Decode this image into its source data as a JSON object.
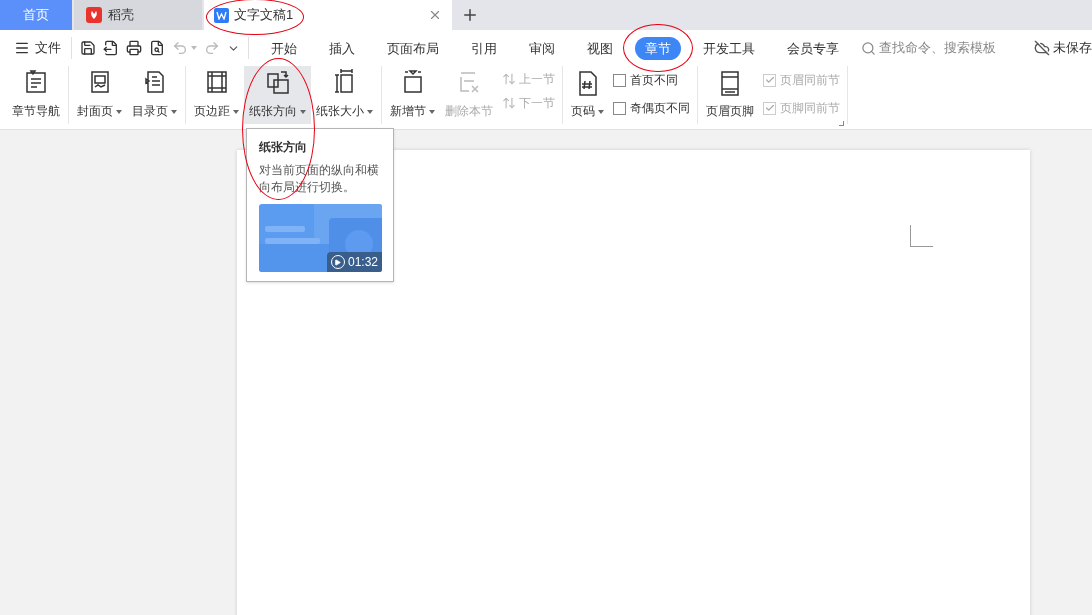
{
  "tabs": [
    {
      "kind": "home",
      "label": "首页",
      "selected": false,
      "circled": false
    },
    {
      "kind": "app",
      "label": "稻壳",
      "selected": false,
      "circled": false
    },
    {
      "kind": "doc",
      "label": "文字文稿1",
      "selected": true,
      "circled": true
    }
  ],
  "file_menu": {
    "label": "文件"
  },
  "menu_tabs": [
    {
      "label": "开始",
      "selected": false,
      "circled": false
    },
    {
      "label": "插入",
      "selected": false,
      "circled": false
    },
    {
      "label": "页面布局",
      "selected": false,
      "circled": false
    },
    {
      "label": "引用",
      "selected": false,
      "circled": false
    },
    {
      "label": "审阅",
      "selected": false,
      "circled": false
    },
    {
      "label": "视图",
      "selected": false,
      "circled": false
    },
    {
      "label": "章节",
      "selected": true,
      "circled": true
    },
    {
      "label": "开发工具",
      "selected": false,
      "circled": false
    },
    {
      "label": "会员专享",
      "selected": false,
      "circled": false
    }
  ],
  "search": {
    "placeholder": "查找命令、搜索模板"
  },
  "save_status": "未保存",
  "ribbon_groups": [
    {
      "items": [
        {
          "kind": "large",
          "label": "章节导航",
          "dropdown": false,
          "disabled": false,
          "hovered": false,
          "circled": false
        }
      ]
    },
    {
      "items": [
        {
          "kind": "large",
          "label": "封面页",
          "dropdown": true,
          "disabled": false,
          "hovered": false,
          "circled": false
        },
        {
          "kind": "large",
          "label": "目录页",
          "dropdown": true,
          "disabled": false,
          "hovered": false,
          "circled": false
        }
      ]
    },
    {
      "items": [
        {
          "kind": "large",
          "label": "页边距",
          "dropdown": true,
          "disabled": false,
          "hovered": false,
          "circled": false
        },
        {
          "kind": "large",
          "label": "纸张方向",
          "dropdown": true,
          "disabled": false,
          "hovered": true,
          "circled": true
        },
        {
          "kind": "large",
          "label": "纸张大小",
          "dropdown": true,
          "disabled": false,
          "hovered": false,
          "circled": false
        }
      ]
    },
    {
      "items": [
        {
          "kind": "large",
          "label": "新增节",
          "dropdown": true,
          "disabled": false,
          "hovered": false,
          "circled": false
        },
        {
          "kind": "large",
          "label": "删除本节",
          "dropdown": false,
          "disabled": true,
          "hovered": false,
          "circled": false
        },
        {
          "kind": "nav",
          "entries": [
            {
              "label": "上一节",
              "disabled": true
            },
            {
              "label": "下一节",
              "disabled": true
            }
          ]
        }
      ]
    },
    {
      "items": [
        {
          "kind": "large",
          "label": "页码",
          "dropdown": true,
          "disabled": false,
          "hovered": false,
          "circled": false
        },
        {
          "kind": "checks",
          "entries": [
            {
              "label": "首页不同",
              "checked": false,
              "disabled": false
            },
            {
              "label": "奇偶页不同",
              "checked": false,
              "disabled": false
            }
          ]
        }
      ]
    },
    {
      "launcher": true,
      "items": [
        {
          "kind": "large",
          "label": "页眉页脚",
          "dropdown": false,
          "disabled": false,
          "hovered": false,
          "circled": false
        },
        {
          "kind": "checks",
          "entries": [
            {
              "label": "页眉同前节",
              "checked": true,
              "disabled": true
            },
            {
              "label": "页脚同前节",
              "checked": true,
              "disabled": true
            }
          ]
        }
      ]
    }
  ],
  "tooltip": {
    "title": "纸张方向",
    "text": "对当前页面的纵向和横向布局进行切换。",
    "video": {
      "kind": "picture",
      "duration": "01:32"
    }
  }
}
